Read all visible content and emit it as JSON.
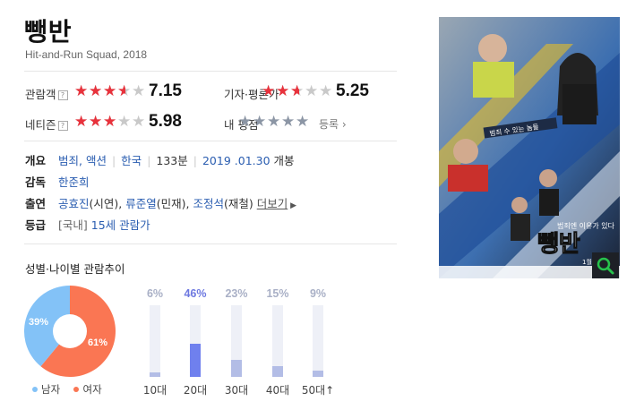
{
  "movie": {
    "title": "뺑반",
    "subtitle": "Hit-and-Run Squad, 2018"
  },
  "ratings": {
    "audience": {
      "label": "관람객",
      "score": "7.15",
      "fill": 0.715
    },
    "critic": {
      "label": "기자·평론가",
      "score": "5.25",
      "fill": 0.525
    },
    "netizen": {
      "label": "네티즌",
      "score": "5.98",
      "fill": 0.598
    },
    "mine": {
      "label": "내 평점",
      "fill": 1.0,
      "register_label": "등록"
    },
    "help_glyph": "?",
    "star_color": "#e8323c",
    "mine_star_color": "#8c96a5"
  },
  "info": {
    "overview": {
      "label": "개요",
      "genre": "범죄, 액션",
      "country": "한국",
      "runtime": "133분",
      "release_date": "2019 .01.30",
      "release_suffix": "개봉"
    },
    "director": {
      "label": "감독",
      "name": "한준희"
    },
    "cast": {
      "label": "출연",
      "actors": [
        {
          "name": "공효진",
          "role": "(시연)"
        },
        {
          "name": "류준열",
          "role": "(민재)"
        },
        {
          "name": "조정석",
          "role": "(재철)"
        }
      ],
      "more_label": "더보기"
    },
    "grade": {
      "label": "등급",
      "prefix": "[국내]",
      "value": "15세 관람가"
    }
  },
  "stats": {
    "title": "성별·나이별 관람추이",
    "gender": {
      "male_pct": "39%",
      "female_pct": "61%",
      "male_value": 39,
      "female_value": 61,
      "male_label": "남자",
      "female_label": "여자",
      "male_color": "#83c2f7",
      "female_color": "#fa7653"
    },
    "age": [
      {
        "label": "10대",
        "pct": "6%",
        "value": 6,
        "highlight": false
      },
      {
        "label": "20대",
        "pct": "46%",
        "value": 46,
        "highlight": true
      },
      {
        "label": "30대",
        "pct": "23%",
        "value": 23,
        "highlight": false
      },
      {
        "label": "40대",
        "pct": "15%",
        "value": 15,
        "highlight": false
      },
      {
        "label": "50대↑",
        "pct": "9%",
        "value": 9,
        "highlight": false
      }
    ]
  },
  "poster": {
    "tagline": "범죄 수 있는 놈들",
    "brand_line": "범죄엔 이유가 있다",
    "date_line": "1월 30일",
    "logo": "뺑반",
    "search_icon": "magnifier-icon"
  }
}
